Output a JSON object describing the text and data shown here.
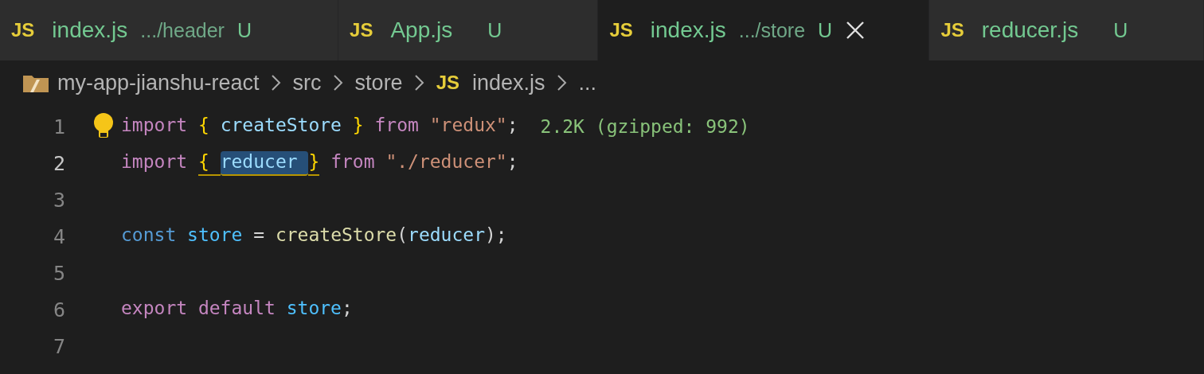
{
  "tabs": [
    {
      "icon": "JS",
      "name": "index.js",
      "path": ".../header",
      "status": "U",
      "selected": false
    },
    {
      "icon": "JS",
      "name": "App.js",
      "status": "U",
      "selected": false
    },
    {
      "icon": "JS",
      "name": "index.js",
      "path": ".../store",
      "status": "U",
      "selected": true
    },
    {
      "icon": "JS",
      "name": "reducer.js",
      "status": "U",
      "selected": false
    }
  ],
  "breadcrumbs": [
    {
      "kind": "folder",
      "label": "my-app-jianshu-react"
    },
    {
      "kind": "folder",
      "label": "src"
    },
    {
      "kind": "folder",
      "label": "store"
    },
    {
      "kind": "file",
      "icon": "JS",
      "label": "index.js"
    },
    {
      "kind": "more",
      "label": "..."
    }
  ],
  "lines": [
    {
      "number": "1",
      "current": false,
      "lightbulb": true,
      "annotation": "2.2K (gzipped: 992)",
      "tokens": [
        {
          "t": "import ",
          "kind": "keyword"
        },
        {
          "t": "{ ",
          "kind": "brace"
        },
        {
          "t": "createStore ",
          "kind": "variable"
        },
        {
          "t": "} ",
          "kind": "brace"
        },
        {
          "t": "from ",
          "kind": "keyword"
        },
        {
          "t": "\"redux\"",
          "kind": "string"
        },
        {
          "t": ";",
          "kind": "plain"
        }
      ]
    },
    {
      "number": "2",
      "current": true,
      "tokens": [
        {
          "t": "import ",
          "kind": "keyword"
        },
        {
          "t": "{ ",
          "kind": "brace",
          "underlined": true
        },
        {
          "t": "reducer ",
          "kind": "variable",
          "underlined": true,
          "highlighted": true
        },
        {
          "t": "}",
          "kind": "brace",
          "underlined": true
        },
        {
          "t": " from ",
          "kind": "keyword"
        },
        {
          "t": "\"./reducer\"",
          "kind": "string"
        },
        {
          "t": ";",
          "kind": "plain"
        }
      ]
    },
    {
      "number": "3",
      "current": false
    },
    {
      "number": "4",
      "current": false,
      "tokens": [
        {
          "t": "const ",
          "kind": "storage"
        },
        {
          "t": "store ",
          "kind": "constant"
        },
        {
          "t": "= ",
          "kind": "plain"
        },
        {
          "t": "createStore",
          "kind": "function"
        },
        {
          "t": "(",
          "kind": "plain"
        },
        {
          "t": "reducer",
          "kind": "variable"
        },
        {
          "t": ");",
          "kind": "plain"
        }
      ]
    },
    {
      "number": "5",
      "current": false
    },
    {
      "number": "6",
      "current": false,
      "tokens": [
        {
          "t": "export default ",
          "kind": "keyword"
        },
        {
          "t": "store",
          "kind": "constant"
        },
        {
          "t": ";",
          "kind": "plain"
        }
      ]
    },
    {
      "number": "7",
      "current": false
    }
  ]
}
